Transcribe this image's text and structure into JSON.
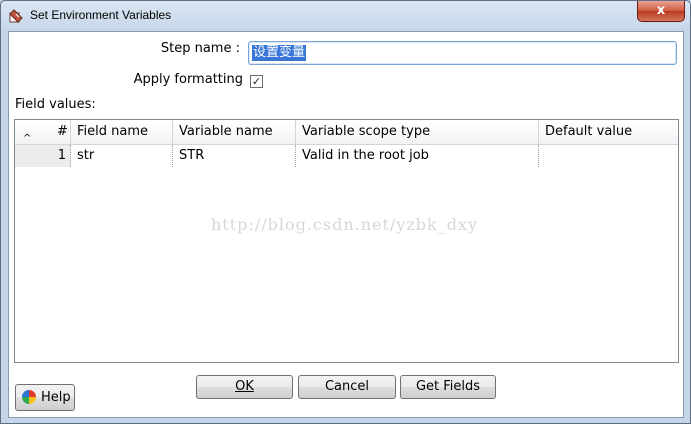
{
  "window": {
    "title": "Set Environment Variables",
    "close_glyph": "x",
    "icon": "transformation-step-icon"
  },
  "form": {
    "step_name_label": "Step name :",
    "step_name_value": "设置变量",
    "apply_formatting_label": "Apply formatting",
    "apply_formatting_checked": true,
    "checkbox_glyph": "✓",
    "field_values_label": "Field values:"
  },
  "table": {
    "sort_glyph": "^",
    "columns": [
      "#",
      "Field name",
      "Variable name",
      "Variable scope type",
      "Default value"
    ],
    "rows": [
      {
        "num": "1",
        "field_name": "str",
        "variable_name": "STR",
        "scope": "Valid in the root job",
        "default": ""
      }
    ]
  },
  "watermark": "http://blog.csdn.net/yzbk_dxy",
  "buttons": {
    "help": "Help",
    "ok": "OK",
    "cancel": "Cancel",
    "get_fields": "Get Fields"
  }
}
